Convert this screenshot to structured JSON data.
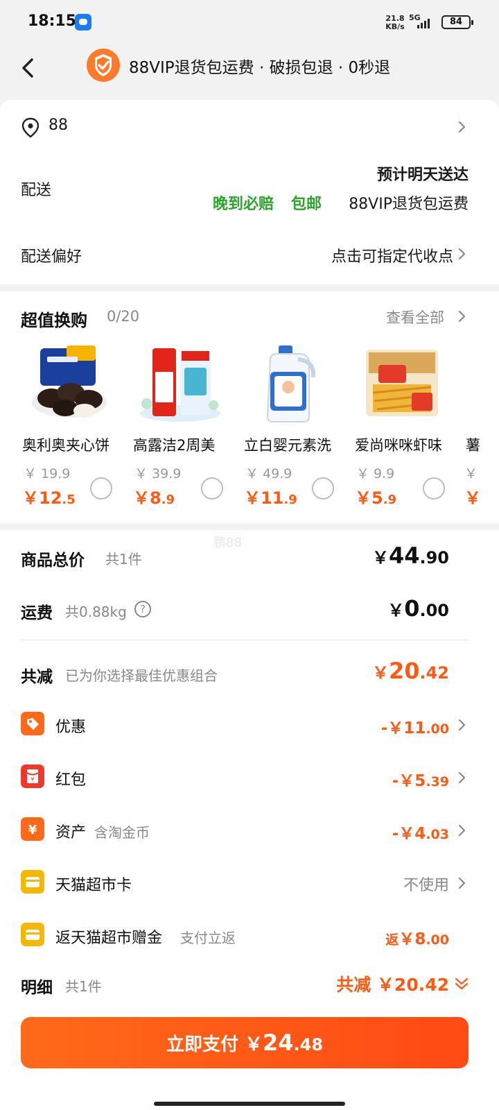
{
  "status_bar": {
    "time": "18:15",
    "net_speed_value": "21.8",
    "net_speed_unit": "KB/s",
    "network": "5G",
    "battery": "84"
  },
  "header": {
    "title": "88VIP退货包运费 · 破损包退 · 0秒退"
  },
  "address": {
    "text": "88"
  },
  "delivery": {
    "label": "配送",
    "eta": "预计明天送达",
    "tags": [
      "晚到必赔",
      "包邮"
    ],
    "return_note": "88VIP退货包运费"
  },
  "preference": {
    "label": "配送偏好",
    "value": "点击可指定代收点"
  },
  "swap": {
    "title": "超值换购",
    "count": "0/20",
    "view_all": "查看全部",
    "products": [
      {
        "name": "奥利奥夹心饼",
        "old_price": "￥ 19.9",
        "price_int": "￥12",
        "price_dec": ".5"
      },
      {
        "name": "高露洁2周美",
        "old_price": "￥ 39.9",
        "price_int": "￥8",
        "price_dec": ".9"
      },
      {
        "name": "立白婴元素洗",
        "old_price": "￥ 49.9",
        "price_int": "￥11",
        "price_dec": ".9"
      },
      {
        "name": "爱尚咪咪虾味",
        "old_price": "￥ 9.9",
        "price_int": "￥5",
        "price_dec": ".9"
      }
    ],
    "partial_name": "薯",
    "partial_price": "￥"
  },
  "watermark": "鹏88",
  "totals": {
    "goods": {
      "label": "商品总价",
      "sub": "共1件",
      "cur": "￥",
      "int": "44",
      "dec": ".90"
    },
    "shipping": {
      "label": "运费",
      "sub": "共0.88kg",
      "cur": "￥",
      "int": "0",
      "dec": ".00"
    },
    "reduction": {
      "label": "共减",
      "sub": "已为你选择最佳优惠组合",
      "cur": "￥",
      "int": "20",
      "dec": ".42"
    }
  },
  "discounts": [
    {
      "label": "优惠",
      "sub": "",
      "amount_int": "-￥11",
      "amount_dec": ".00"
    },
    {
      "label": "红包",
      "sub": "",
      "amount_int": "-￥5",
      "amount_dec": ".39"
    },
    {
      "label": "资产",
      "sub": "含淘金币",
      "amount_int": "-￥4",
      "amount_dec": ".03"
    },
    {
      "label": "天猫超市卡",
      "sub": "",
      "value": "不使用"
    },
    {
      "label": "返天猫超市赠金",
      "sub": "支付立返",
      "prefix": "返",
      "amount_int": "￥8",
      "amount_dec": ".00"
    }
  ],
  "detail": {
    "label": "明细",
    "sub": "共1件",
    "summary": "共减 ￥20.42"
  },
  "pay": {
    "label": "立即支付 ￥",
    "int": "24",
    "dec": ".48"
  },
  "colors": {
    "accent": "#ff5a14",
    "green": "#2aa52a",
    "page_bg": "#f2f2f2"
  },
  "icons": {
    "back": "back-arrow-icon",
    "shield": "shield-check-icon",
    "pin": "location-pin-icon",
    "tag": "coupon-tag-icon",
    "redpacket": "red-packet-icon",
    "asset": "yuan-coin-icon",
    "card": "wallet-card-icon",
    "gift": "gift-card-icon"
  }
}
